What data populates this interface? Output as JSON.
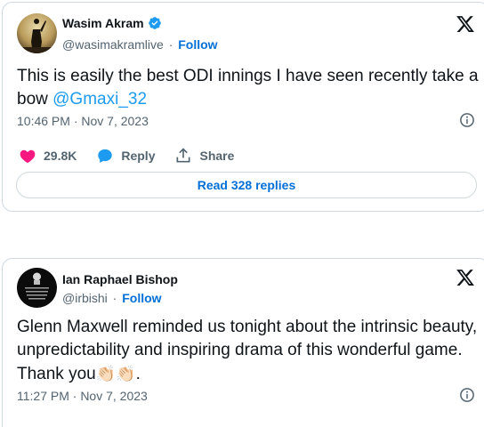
{
  "tweet1": {
    "author_name": "Wasim Akram",
    "handle": "@wasimakramlive",
    "separator": "·",
    "follow_label": "Follow",
    "text_before": "This is easily the best ODI innings I have seen recently take a bow ",
    "mention": "@Gmaxi_32",
    "timestamp": "10:46 PM · Nov 7, 2023",
    "like_count": "29.8K",
    "reply_label": "Reply",
    "share_label": "Share",
    "read_replies_label": "Read 328 replies"
  },
  "tweet2": {
    "author_name": "Ian Raphael Bishop",
    "handle": "@irbishi",
    "separator": "·",
    "follow_label": "Follow",
    "text": "Glenn Maxwell reminded us tonight about the intrinsic beauty, unpredictability and inspiring drama of this wonderful game. Thank you",
    "emoji": "👏🏻👏🏻",
    "text_end": ".",
    "timestamp": "11:27 PM · Nov 7, 2023",
    "avatar_caption": "I BEGIN TO SPEAK ONLY WHEN I'M CERTAIN WHAT I'LL SAY ISN'T BETTER LEFT UNSAID"
  },
  "colors": {
    "link": "#1d9bf0",
    "follow": "#006fd6",
    "like": "#f91880",
    "verified": "#1d9bf0",
    "secondary_text": "#536471",
    "border": "#cfd9de"
  },
  "icons": {
    "verified": "verified-badge-icon",
    "x": "x-logo-icon",
    "info": "info-icon",
    "like": "heart-icon",
    "reply": "reply-bubble-icon",
    "share": "share-upload-icon"
  }
}
